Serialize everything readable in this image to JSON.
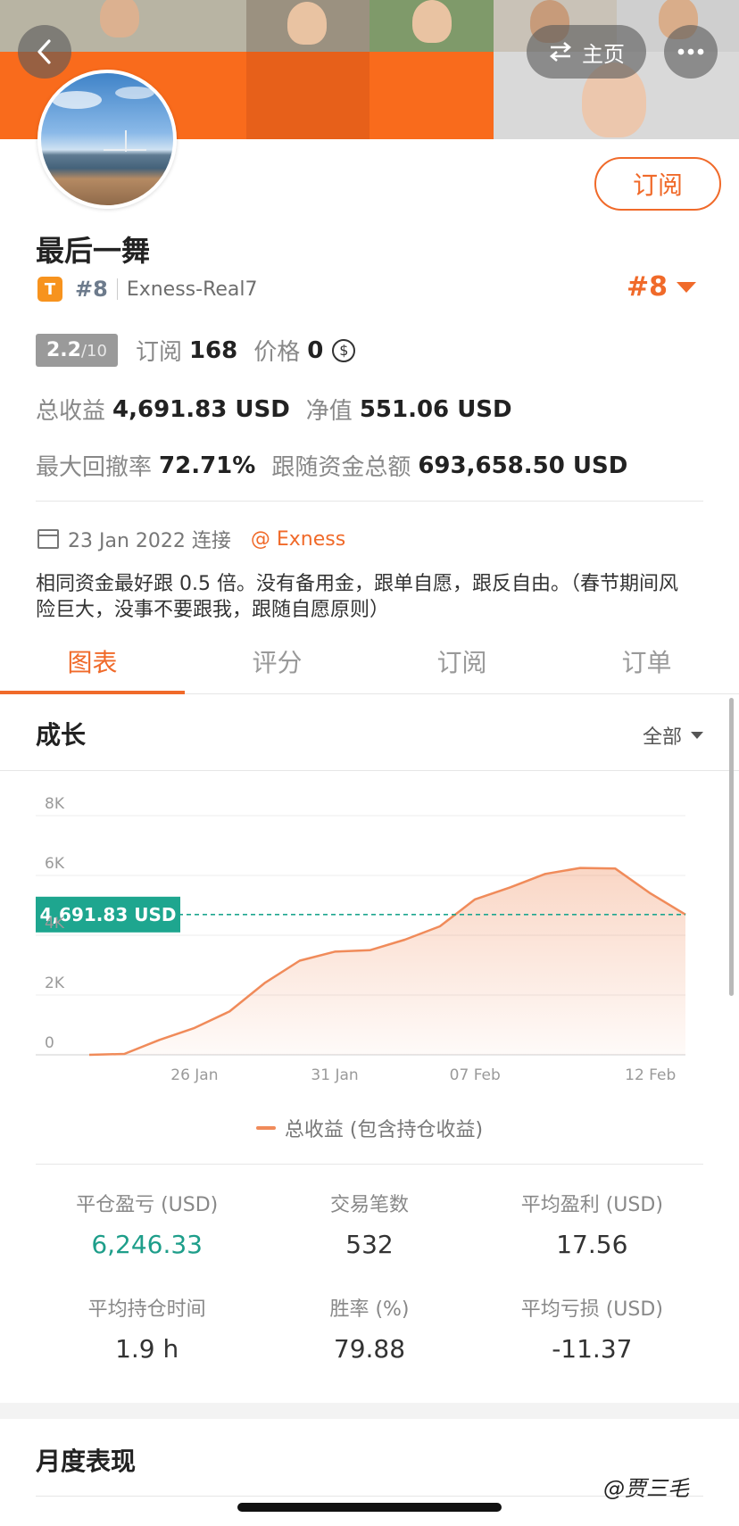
{
  "header": {
    "home_label": "主页",
    "subscribe_label": "订阅"
  },
  "profile": {
    "name": "最后一舞",
    "badge_letter": "T",
    "rank": "#8",
    "account": "Exness-Real7",
    "rank_display": "#8"
  },
  "stats": {
    "score": "2.2",
    "score_max": "/10",
    "subscribers_label": "订阅",
    "subscribers": "168",
    "price_label": "价格",
    "price": "0",
    "price_currency_symbol": "$",
    "total_profit_label": "总收益",
    "total_profit": "4,691.83 USD",
    "equity_label": "净值",
    "equity": "551.06 USD",
    "max_drawdown_label": "最大回撤率",
    "max_drawdown": "72.71%",
    "copy_funds_label": "跟随资金总额",
    "copy_funds": "693,658.50 USD"
  },
  "connect": {
    "date_text": "23 Jan 2022 连接",
    "broker": "@ Exness"
  },
  "description": "相同资金最好跟 0.5 倍。没有备用金，跟单自愿，跟反自由。（春节期间风险巨大，没事不要跟我，跟随自愿原则）",
  "tabs": [
    "图表",
    "评分",
    "订阅",
    "订单"
  ],
  "growth": {
    "title": "成长",
    "filter": "全部"
  },
  "chart_data": {
    "type": "area",
    "y_ticks": [
      "0",
      "2K",
      "4K",
      "6K",
      "8K"
    ],
    "ylim": [
      0,
      8000
    ],
    "x_ticks": [
      "26 Jan",
      "31 Jan",
      "07 Feb",
      "12 Feb"
    ],
    "x": [
      "23 Jan",
      "24 Jan",
      "25 Jan",
      "26 Jan",
      "27 Jan",
      "28 Jan",
      "29 Jan",
      "31 Jan",
      "01 Feb",
      "03 Feb",
      "04 Feb",
      "07 Feb",
      "08 Feb",
      "09 Feb",
      "10 Feb",
      "11 Feb",
      "12 Feb",
      "13 Feb"
    ],
    "values": [
      0,
      30,
      500,
      900,
      1450,
      2400,
      3150,
      3450,
      3500,
      3850,
      4300,
      5200,
      5600,
      6050,
      6250,
      6230,
      5400,
      4691.83
    ],
    "current_label": "4,691.83 USD",
    "current_value": 4691.83,
    "legend": "总收益 (包含持仓收益)",
    "line_color": "#f08b5a",
    "marker_color": "#1ea68f"
  },
  "metrics": [
    {
      "label": "平仓盈亏 (USD)",
      "value": "6,246.33",
      "color": "green"
    },
    {
      "label": "交易笔数",
      "value": "532",
      "color": "normal"
    },
    {
      "label": "平均盈利 (USD)",
      "value": "17.56",
      "color": "normal"
    },
    {
      "label": "平均持仓时间",
      "value": "1.9 h",
      "color": "normal"
    },
    {
      "label": "胜率 (%)",
      "value": "79.88",
      "color": "normal"
    },
    {
      "label": "平均亏损 (USD)",
      "value": "-11.37",
      "color": "normal"
    }
  ],
  "monthly_title": "月度表现",
  "watermark": "@贾三毛",
  "colors": {
    "accent": "#f06a2a",
    "positive": "#1e9e8a"
  }
}
